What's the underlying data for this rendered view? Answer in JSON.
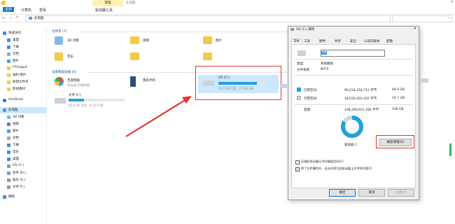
{
  "window": {
    "ribbon_tabs": [
      "文件",
      "计算机",
      "查看",
      "驱动器工具"
    ],
    "manage_tab": "管理",
    "title": "此电脑",
    "address": "此电脑"
  },
  "sidebar": {
    "items": [
      {
        "label": "快速访问",
        "icon": "star-icon"
      },
      {
        "label": "桌面",
        "icon": "desktop-icon"
      },
      {
        "label": "下载",
        "icon": "download-icon"
      },
      {
        "label": "文档",
        "icon": "document-icon"
      },
      {
        "label": "图片",
        "icon": "picture-icon"
      },
      {
        "label": "FFOutput",
        "icon": "folder-icon"
      },
      {
        "label": "福利 图片",
        "icon": "folder-icon"
      },
      {
        "label": "新建文件夹",
        "icon": "folder-icon"
      },
      {
        "label": "影视素材",
        "icon": "folder-icon"
      },
      {
        "label": "OneDrive",
        "icon": "cloud-icon"
      },
      {
        "label": "此电脑",
        "icon": "computer-icon"
      },
      {
        "label": "3D 对象",
        "icon": "cube-icon"
      },
      {
        "label": "视频",
        "icon": "video-icon"
      },
      {
        "label": "图片",
        "icon": "picture-icon"
      },
      {
        "label": "文档",
        "icon": "document-icon"
      },
      {
        "label": "下载",
        "icon": "download-icon"
      },
      {
        "label": "音乐",
        "icon": "music-icon"
      },
      {
        "label": "桌面",
        "icon": "desktop-icon"
      },
      {
        "label": "OS (C:)",
        "icon": "drive-icon"
      },
      {
        "label": "软件 (D:)",
        "icon": "drive-icon"
      },
      {
        "label": "娱乐 (E:)",
        "icon": "drive-icon"
      },
      {
        "label": "文件 (F:)",
        "icon": "drive-icon"
      },
      {
        "label": "网络",
        "icon": "network-icon"
      }
    ]
  },
  "content": {
    "folders_header": "文件夹 (7)",
    "folders": [
      "3D 对象",
      "视频",
      "图片",
      "音乐"
    ],
    "drives_header": "设备和驱动器 (6)",
    "apps": [
      {
        "name": "百度网盘",
        "sub": "双击运行百度网盘"
      },
      {
        "name": "我的手机",
        "sub": ""
      }
    ],
    "drive_f": {
      "name": "文件 (F:)",
      "free": "92.0 GB 可用，共 127 GB",
      "used_fraction": 0.28
    },
    "drive_c": {
      "name": "OS (C:)",
      "free": "16.7 GB 可用，共 100 GB",
      "used_fraction": 0.83
    }
  },
  "dialog": {
    "title": "OS (C:) 属性",
    "tabs": [
      "常规",
      "工具",
      "硬件",
      "共享",
      "安全",
      "以前的版本",
      "配额"
    ],
    "name_field": "OS",
    "type_label": "类型:",
    "type_value": "本地磁盘",
    "fs_label": "文件系统:",
    "fs_value": "NTFS",
    "used_label": "已用空间:",
    "used_bytes": "90,234,218,712 字节",
    "used_gb": "84.0 GB",
    "free_label": "可用空间:",
    "free_bytes": "18,032,402,432 字节",
    "free_gb": "16.7 GB",
    "capacity_label": "容量:",
    "capacity_bytes": "108,266,621,184 字节",
    "capacity_gb": "100 GB",
    "drive_label": "驱动器 C:",
    "cleanup_button": "磁盘清理(D)",
    "compress_label": "压缩此驱动器以节约磁盘空间(C)",
    "index_label": "除了文件属性外，还允许索引此驱动器上文件的内容(I)",
    "ok": "确定",
    "cancel": "取消",
    "apply": "应用(A)",
    "used_fraction": 0.834,
    "colors": {
      "used": "#26a0da",
      "free": "#d6d6d6"
    }
  }
}
